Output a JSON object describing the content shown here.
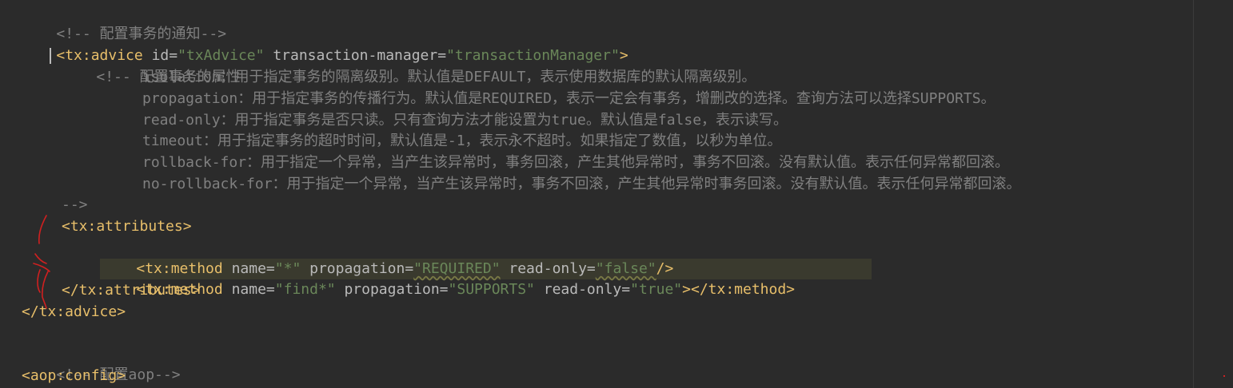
{
  "code": {
    "l1_comment": "<!-- 配置事务的通知-->",
    "l2_open": "<tx:advice ",
    "l2_attr1": "id=",
    "l2_val1": "\"txAdvice\"",
    "l2_sp": " ",
    "l2_attr2": "transaction-manager=",
    "l2_val2": "\"transactionManager\"",
    "l2_close": ">",
    "l3_comment": "<!-- 配置事务的属性",
    "l4": "isolation：用于指定事务的隔离级别。默认值是DEFAULT，表示使用数据库的默认隔离级别。",
    "l5": "propagation：用于指定事务的传播行为。默认值是REQUIRED，表示一定会有事务，增删改的选择。查询方法可以选择SUPPORTS。",
    "l6": "read-only：用于指定事务是否只读。只有查询方法才能设置为true。默认值是false，表示读写。",
    "l7": "timeout：用于指定事务的超时时间，默认值是-1，表示永不超时。如果指定了数值，以秒为单位。",
    "l8": "rollback-for：用于指定一个异常，当产生该异常时，事务回滚，产生其他异常时，事务不回滚。没有默认值。表示任何异常都回滚。",
    "l9": "no-rollback-for：用于指定一个异常，当产生该异常时，事务不回滚，产生其他异常时事务回滚。没有默认值。表示任何异常都回滚。",
    "l10_comment": "-->",
    "l11_tag": "<tx:attributes>",
    "l12_open": "<tx:method ",
    "l12_a1": "name=",
    "l12_v1": "\"*\"",
    "l12_a2": " propagation=",
    "l12_v2": "\"REQUIRED\"",
    "l12_a3": " read-only=",
    "l12_v3": "\"false\"",
    "l12_close": "/>",
    "l13_open": "<tx:method ",
    "l13_a1": "name=",
    "l13_v1": "\"find*\"",
    "l13_a2": " propagation=",
    "l13_v2": "\"SUPPORTS\"",
    "l13_a3": " read-only=",
    "l13_v3": "\"true\"",
    "l13_close": "></tx:method>",
    "l14_tag": "</tx:attributes>",
    "l15_tag": "</tx:advice>",
    "l17_comment": "<!-- 配置aop-->",
    "l18_tag": "<aop:config>"
  },
  "colors": {
    "background": "#2b2b2b",
    "comment": "#808080",
    "tag": "#e8bf6a",
    "attribute": "#bababa",
    "value": "#6a8759",
    "annotation": "#d02020"
  }
}
